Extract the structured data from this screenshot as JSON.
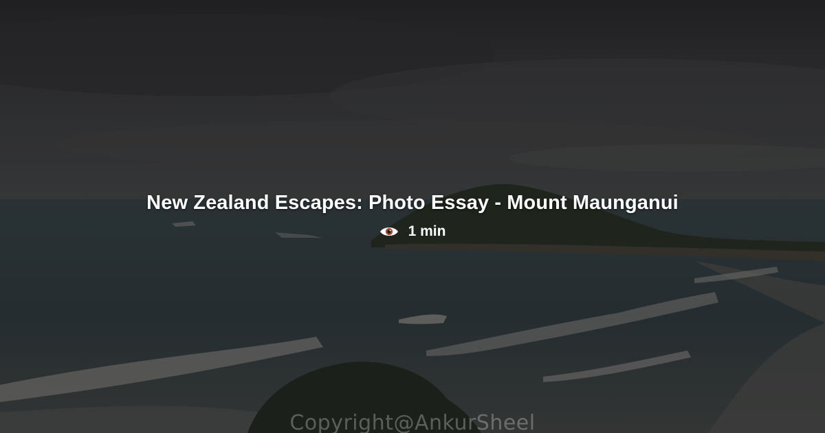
{
  "post": {
    "title": "New Zealand Escapes: Photo Essay - Mount Maunganui",
    "read_time": "1 min",
    "read_icon": "eye-icon"
  },
  "photo": {
    "watermark": "Copyright@AnkurSheel"
  },
  "colors": {
    "text": "#ffffff",
    "sky": "#4a4a4e",
    "sea": "#3d4f55",
    "foam": "#c9c6bd",
    "hill": "#2d3a22"
  }
}
